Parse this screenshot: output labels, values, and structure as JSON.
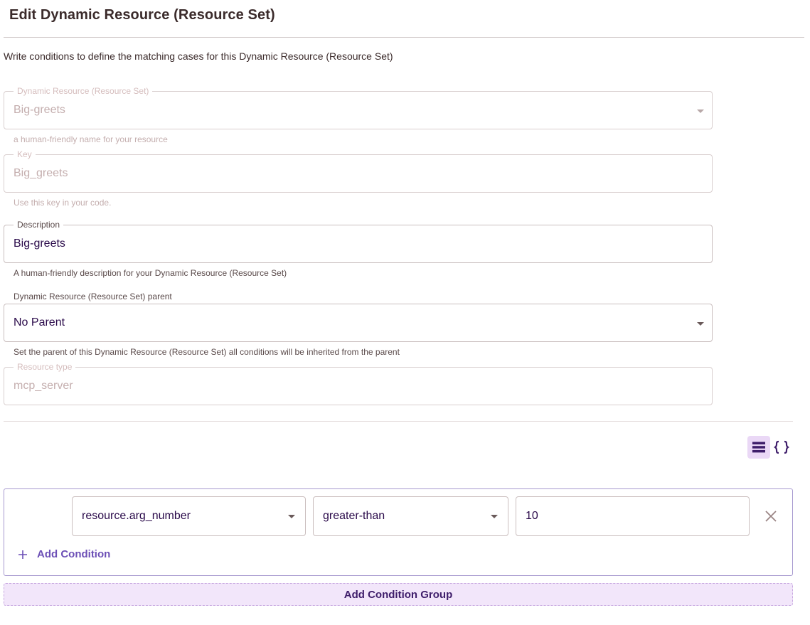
{
  "page": {
    "title": "Edit Dynamic Resource (Resource Set)",
    "intro": "Write conditions to define the matching cases for this Dynamic Resource (Resource Set)"
  },
  "form": {
    "name": {
      "label": "Dynamic Resource (Resource Set)",
      "value": "Big-greets",
      "helper": "a human-friendly name for your resource"
    },
    "key": {
      "label": "Key",
      "value": "Big_greets",
      "helper": "Use this key in your code."
    },
    "description": {
      "label": "Description",
      "value": "Big-greets",
      "helper": "A human-friendly description for your Dynamic Resource (Resource Set)"
    },
    "parent": {
      "label": "Dynamic Resource (Resource Set) parent",
      "value": "No Parent",
      "helper": "Set the parent of this Dynamic Resource (Resource Set) all conditions will be inherited from the parent"
    },
    "resource_type": {
      "label": "Resource type",
      "value": "mcp_server"
    }
  },
  "view_toggle": {
    "active": "list",
    "icons": [
      "list-view-icon",
      "code-braces-icon"
    ]
  },
  "conditions": {
    "rows": [
      {
        "attribute": "resource.arg_number",
        "operator": "greater-than",
        "value": "10"
      }
    ],
    "add_condition_label": "Add Condition",
    "add_group_label": "Add Condition Group"
  },
  "colors": {
    "accent": "#6c4fb6",
    "accent_dark": "#3e1d6a",
    "active_toggle_bg": "#ead8f6",
    "add_group_bg": "#f2e6fa",
    "group_border": "#a89ad0"
  }
}
